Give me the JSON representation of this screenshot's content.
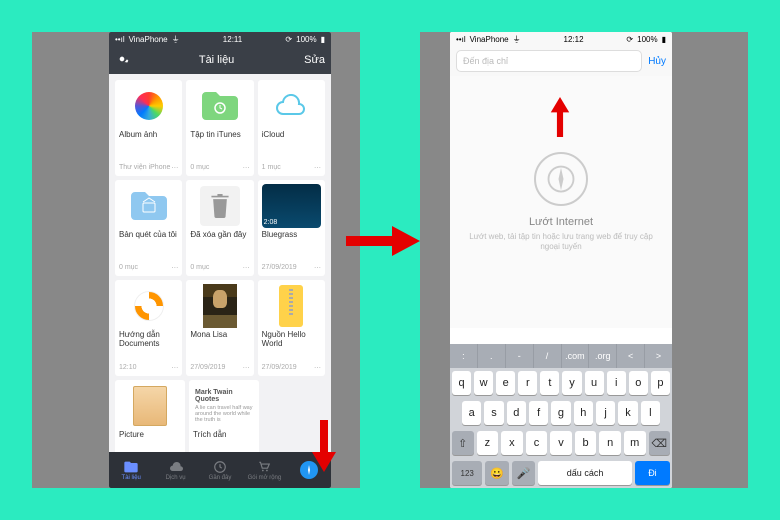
{
  "left": {
    "status": {
      "carrier": "VinaPhone",
      "time": "12:11",
      "battery": "100%"
    },
    "nav": {
      "title": "Tài liệu",
      "edit": "Sửa"
    },
    "tiles": [
      {
        "name": "Album ảnh",
        "meta_left": "Thư viện iPhone",
        "thumb": "photos"
      },
      {
        "name": "Tập tin iTunes",
        "meta_left": "0 mục",
        "thumb": "folder-green"
      },
      {
        "name": "iCloud",
        "meta_left": "1 mục",
        "thumb": "cloud"
      },
      {
        "name": "Bản quét của tôi",
        "meta_left": "0 mục",
        "thumb": "folder-blue"
      },
      {
        "name": "Đã xóa gần đây",
        "meta_left": "0 mục",
        "thumb": "trash"
      },
      {
        "name": "Bluegrass",
        "meta_left": "27/09/2019",
        "thumb": "bluegrass",
        "badge": "2:08"
      },
      {
        "name": "Hướng dẫn Documents",
        "meta_left": "12:10",
        "thumb": "lifering"
      },
      {
        "name": "Mona Lisa",
        "meta_left": "27/09/2019",
        "thumb": "mona"
      },
      {
        "name": "Nguồn Hello World",
        "meta_left": "27/09/2019",
        "thumb": "zipper"
      },
      {
        "name": "Picture",
        "meta_left": "",
        "thumb": "picture"
      },
      {
        "name": "Trích dẫn",
        "meta_left": "",
        "thumb": "quotes",
        "q_title": "Mark Twain Quotes",
        "q_body": "A lie can travel half way around the world while the truth is"
      }
    ],
    "tabs": [
      {
        "label": "Tài liệu",
        "icon": "folder",
        "active": true
      },
      {
        "label": "Dịch vụ",
        "icon": "cloud"
      },
      {
        "label": "Gần đây",
        "icon": "clock"
      },
      {
        "label": "Gói mở rộng",
        "icon": "cart"
      },
      {
        "label": "",
        "icon": "compass"
      }
    ]
  },
  "right": {
    "status": {
      "carrier": "VinaPhone",
      "time": "12:12",
      "battery": "100%"
    },
    "search": {
      "placeholder": "Đến địa chỉ",
      "cancel": "Hủy"
    },
    "empty": {
      "title": "Lướt Internet",
      "sub": "Lướt web, tải tập tin hoặc lưu trang web để truy cập ngoại tuyến"
    },
    "kb": {
      "acc": [
        ":",
        ".",
        "-",
        "/",
        ".com",
        ".org",
        "<",
        ">"
      ],
      "r1": [
        "q",
        "w",
        "e",
        "r",
        "t",
        "y",
        "u",
        "i",
        "o",
        "p"
      ],
      "r2": [
        "a",
        "s",
        "d",
        "f",
        "g",
        "h",
        "j",
        "k",
        "l"
      ],
      "r3_shift": "⇧",
      "r3": [
        "z",
        "x",
        "c",
        "v",
        "b",
        "n",
        "m"
      ],
      "r3_del": "⌫",
      "r4_num": "123",
      "r4_emoji": "😀",
      "r4_mic": "🎤",
      "r4_space": "dấu cách",
      "r4_go": "Đi"
    }
  },
  "sig": "@"
}
